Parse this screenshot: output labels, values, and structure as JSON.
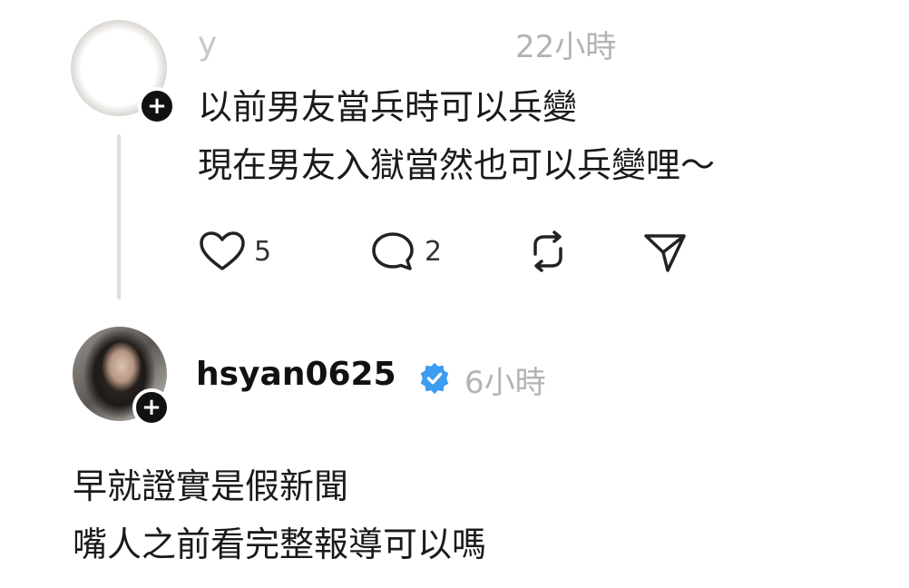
{
  "post1": {
    "username": "y",
    "timestamp": "22小時",
    "lines": [
      "以前男友當兵時可以兵變",
      "現在男友入獄當然也可以兵變哩～"
    ],
    "likes": "5",
    "replies": "2",
    "icons": [
      "heart-icon",
      "comment-icon",
      "repost-icon",
      "send-icon"
    ]
  },
  "post2": {
    "username": "hsyan0625",
    "verified_color": "#3b9cf0",
    "timestamp": "6小時",
    "lines": [
      "早就證實是假新聞",
      "嘴人之前看完整報導可以嗎"
    ]
  },
  "colors": {
    "badge": "#111111",
    "muted": "#b3b3b3",
    "thread_line": "#dedede"
  }
}
